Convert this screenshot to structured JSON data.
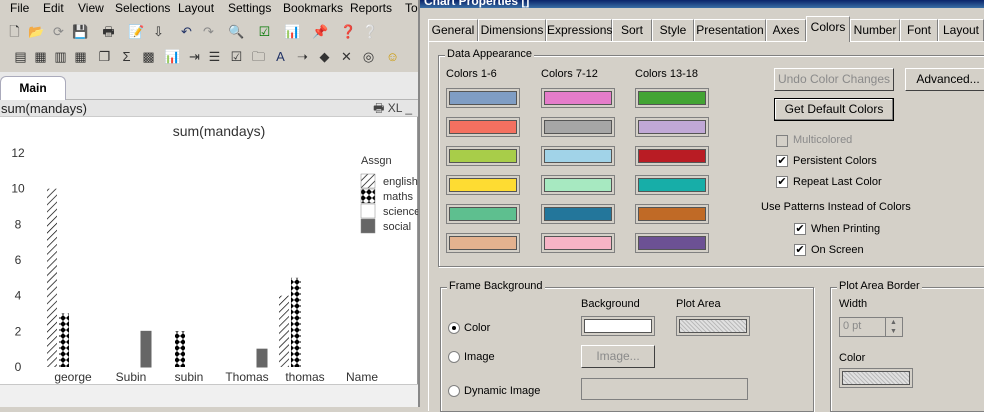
{
  "menu": [
    {
      "label": "File"
    },
    {
      "label": "Edit"
    },
    {
      "label": "View"
    },
    {
      "label": "Selections"
    },
    {
      "label": "Layout"
    },
    {
      "label": "Settings"
    },
    {
      "label": "Bookmarks"
    },
    {
      "label": "Reports"
    },
    {
      "label": "To"
    }
  ],
  "sheet_tab": "Main",
  "chart_caption": "sum(mandays)",
  "caption_icons": "🖶 XL _",
  "chart_data": {
    "type": "bar",
    "title": "sum(mandays)",
    "categories": [
      "george",
      "Subin",
      "subin",
      "Thomas",
      "thomas",
      "Name"
    ],
    "ylim": [
      0,
      12
    ],
    "yticks": [
      "0",
      "2",
      "4",
      "6",
      "8",
      "10",
      "12"
    ],
    "legend_title": "Assgn",
    "legend_placement": "right",
    "series": [
      {
        "name": "english",
        "values": [
          10,
          0,
          0,
          0,
          4,
          0
        ]
      },
      {
        "name": "maths",
        "values": [
          3,
          0,
          2,
          0,
          5,
          0
        ]
      },
      {
        "name": "science",
        "values": [
          0,
          0,
          0,
          0,
          0,
          0
        ]
      },
      {
        "name": "social",
        "values": [
          0,
          2,
          0,
          1,
          0,
          0
        ]
      }
    ]
  },
  "dialog": {
    "title": "Chart Properties []",
    "tabs": [
      "General",
      "Dimensions",
      "Expressions",
      "Sort",
      "Style",
      "Presentation",
      "Axes",
      "Colors",
      "Number",
      "Font",
      "Layout"
    ],
    "active_tab": "Colors",
    "data_appearance": {
      "title": "Data Appearance",
      "col_labels": [
        "Colors 1-6",
        "Colors 7-12",
        "Colors 13-18"
      ],
      "colors": [
        [
          "#7f9dc4",
          "#f47060",
          "#a8cd49",
          "#fedc32",
          "#5ebf8f",
          "#e4b28f"
        ],
        [
          "#e57cca",
          "#a6a6a6",
          "#a1d3e8",
          "#a7e9c1",
          "#23769b",
          "#f7b4c6"
        ],
        [
          "#43a434",
          "#c0a8d6",
          "#b91c24",
          "#17aea8",
          "#c06a26",
          "#6c5194"
        ]
      ]
    },
    "buttons": {
      "undo": "Undo Color Changes",
      "advanced": "Advanced...",
      "default": "Get Default Colors"
    },
    "checks": {
      "multicolored": "Multicolored",
      "persistent": "Persistent Colors",
      "repeat": "Repeat Last Color",
      "patterns_title": "Use Patterns Instead of Colors",
      "printing": "When Printing",
      "onscreen": "On Screen"
    },
    "frame_bg": {
      "title": "Frame Background",
      "background_label": "Background",
      "plot_area_label": "Plot Area",
      "color": "Color",
      "image": "Image",
      "image_button": "Image...",
      "dynamic_image": "Dynamic Image"
    },
    "plot_border": {
      "title": "Plot Area Border",
      "width_label": "Width",
      "width_value": "0 pt",
      "color_label": "Color"
    }
  }
}
